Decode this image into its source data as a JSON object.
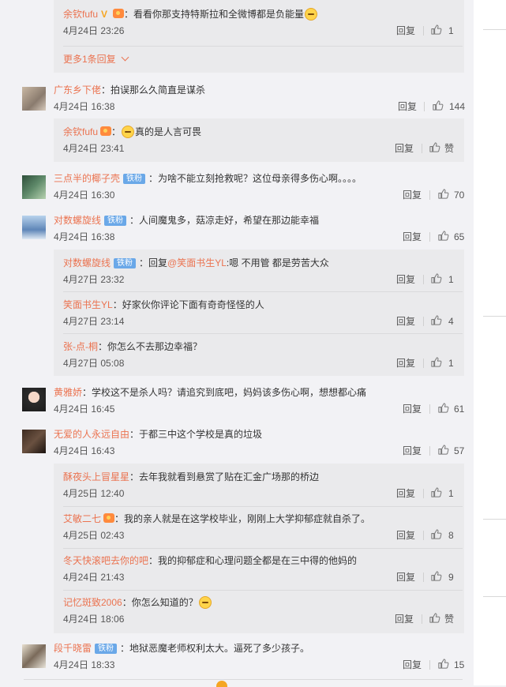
{
  "comments": [
    {
      "user": "广东乡下佬",
      "text": "：拍误那么久简直是谋杀",
      "time": "4月24日 16:38",
      "reply_label": "回复",
      "likes": "144",
      "avatar": "avatar-photo"
    },
    {
      "user": "三点半的椰子壳",
      "badge": "铁粉",
      "text": "：为啥不能立刻抢救呢？这位母亲得多伤心啊。。。。",
      "time": "4月24日 16:30",
      "reply_label": "回复",
      "likes": "70"
    },
    {
      "user": "对数螺旋线",
      "badge": "铁粉",
      "text": "：人间魔鬼多，菇凉走好，希望在那边能幸福",
      "time": "4月24日 16:38",
      "reply_label": "回复",
      "likes": "65"
    },
    {
      "user": "黄雅娇",
      "text": "：学校这不是杀人吗？请追究到底吧，妈妈该多伤心啊，想想都心痛",
      "time": "4月24日 16:45",
      "reply_label": "回复",
      "likes": "61"
    },
    {
      "user": "无爱的人永远自由",
      "text": "：于都三中这个学校是真的垃圾",
      "time": "4月24日 16:43",
      "reply_label": "回复",
      "likes": "57"
    },
    {
      "user": "段千晓雷",
      "badge": "铁粉",
      "text": "：地狱恶魔老师权利太大。逼死了多少孩子。",
      "time": "4月24日 18:33",
      "reply_label": "回复",
      "likes": "15"
    }
  ],
  "replies_top": [
    {
      "user": "余钦fufu",
      "text": "：看看你那支持特斯拉和全微博都是负能量",
      "time": "4月24日 23:26",
      "reply_label": "回复",
      "likes": "1"
    }
  ],
  "more_replies": "更多1条回复",
  "replies_c1": [
    {
      "user": "余钦fufu",
      "text": "真的是人言可畏",
      "time": "4月24日 23:41",
      "reply_label": "回复",
      "likes": "赞"
    }
  ],
  "replies_c3": [
    {
      "user": "对数螺旋线",
      "badge": "铁粉",
      "prefix": "：回复",
      "at": "@笑面书生YL",
      "text": ":嗯  不用管  都是劳苦大众",
      "time": "4月27日 23:32",
      "reply_label": "回复",
      "likes": "1"
    },
    {
      "user": "笑面书生YL",
      "text": "：好家伙你评论下面有奇奇怪怪的人",
      "time": "4月27日 23:14",
      "reply_label": "回复",
      "likes": "4"
    },
    {
      "user": "张-点-桐",
      "text": "：你怎么不去那边幸福？",
      "time": "4月27日 05:08",
      "reply_label": "回复",
      "likes": "1"
    }
  ],
  "replies_c5": [
    {
      "user": "酥夜头上冒星星",
      "text": "：去年我就看到悬赏了贴在汇金广场那的桥边",
      "time": "4月25日 12:40",
      "reply_label": "回复",
      "likes": "1"
    },
    {
      "user": "艾敏二七",
      "text": "：我的亲人就是在这学校毕业，刚刚上大学抑郁症就自杀了。",
      "time": "4月25日 02:43",
      "reply_label": "回复",
      "likes": "8"
    },
    {
      "user": "冬天快滚吧去你的吧",
      "text": "：我的抑郁症和心理问题全都是在三中得的他妈的",
      "time": "4月24日 21:43",
      "reply_label": "回复",
      "likes": "9"
    },
    {
      "user": "记忆斑致2006",
      "text": "：你怎么知道的？",
      "time": "4月24日 18:06",
      "reply_label": "回复",
      "likes": "赞"
    }
  ],
  "colors": {
    "accent": "#eb7350",
    "fan_badge": "#6aa8e8",
    "background": "#f2f2f5",
    "subbox": "#eaeaec"
  }
}
